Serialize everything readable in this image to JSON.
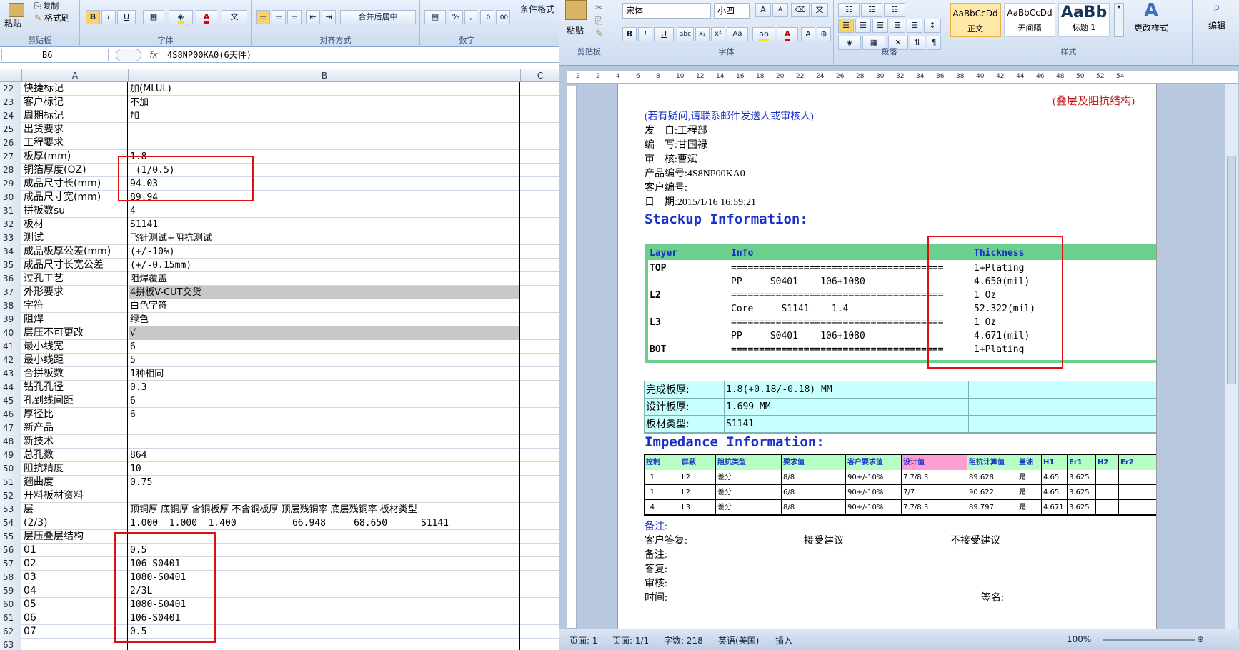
{
  "excel": {
    "ribbon": {
      "paste": "粘贴",
      "copy": "复制",
      "format_painter": "格式刷",
      "clipboard": "剪贴板",
      "font": "字体",
      "alignment": "对齐方式",
      "merge_center": "合并后居中",
      "number": "数字",
      "conditional_format": "条件格式",
      "bold": "B",
      "italic": "I",
      "underline": "U",
      "font_color_a": "A",
      "percent": "%",
      "comma": ","
    },
    "name_box": "B6",
    "fx": "fx",
    "formula_value": "4S8NP00KA0(6天件)",
    "columns": [
      "A",
      "B",
      "C"
    ],
    "rows": [
      {
        "n": "22",
        "a": "快捷标记",
        "b": "加(MLUL)"
      },
      {
        "n": "23",
        "a": "客户标记",
        "b": "不加"
      },
      {
        "n": "24",
        "a": "周期标记",
        "b": "加"
      },
      {
        "n": "25",
        "a": "出货要求",
        "b": ""
      },
      {
        "n": "26",
        "a": "工程要求",
        "b": ""
      },
      {
        "n": "27",
        "a": "板厚(mm)",
        "b": "1.8"
      },
      {
        "n": "28",
        "a": "铜箔厚度(OZ)",
        "b": " (1/0.5)"
      },
      {
        "n": "29",
        "a": "成品尺寸长(mm)",
        "b": "94.03"
      },
      {
        "n": "30",
        "a": "成品尺寸宽(mm)",
        "b": "89.94"
      },
      {
        "n": "31",
        "a": "拼板数su",
        "b": "4"
      },
      {
        "n": "32",
        "a": "板材",
        "b": "S1141"
      },
      {
        "n": "33",
        "a": "测试",
        "b": "飞针测试+阻抗测试"
      },
      {
        "n": "34",
        "a": "成品板厚公差(mm)",
        "b": "(+/-10%)"
      },
      {
        "n": "35",
        "a": "成品尺寸长宽公差",
        "b": "(+/-0.15mm)"
      },
      {
        "n": "36",
        "a": "过孔工艺",
        "b": "阻焊覆盖"
      },
      {
        "n": "37",
        "a": "外形要求",
        "b": "4拼板V-CUT交货"
      },
      {
        "n": "38",
        "a": "字符",
        "b": "白色字符"
      },
      {
        "n": "39",
        "a": "阻焊",
        "b": "绿色"
      },
      {
        "n": "40",
        "a": "层压不可更改",
        "b": "√"
      },
      {
        "n": "41",
        "a": "最小线宽",
        "b": "6"
      },
      {
        "n": "42",
        "a": "最小线距",
        "b": "5"
      },
      {
        "n": "43",
        "a": "合拼板数",
        "b": "1种相同"
      },
      {
        "n": "44",
        "a": "钻孔孔径",
        "b": "0.3"
      },
      {
        "n": "45",
        "a": "孔到线间距",
        "b": "6"
      },
      {
        "n": "46",
        "a": "厚径比",
        "b": "6"
      },
      {
        "n": "47",
        "a": "新产品",
        "b": ""
      },
      {
        "n": "48",
        "a": "新技术",
        "b": ""
      },
      {
        "n": "49",
        "a": "总孔数",
        "b": "864"
      },
      {
        "n": "50",
        "a": "阻抗精度",
        "b": "10"
      },
      {
        "n": "51",
        "a": "翘曲度",
        "b": "0.75"
      },
      {
        "n": "52",
        "a": "开料板材资料",
        "b": ""
      },
      {
        "n": "53",
        "a": "层",
        "b": "顶铜厚 底铜厚 含铜板厚 不含铜板厚 顶层残铜率 底层残铜率 板材类型"
      },
      {
        "n": "54",
        "a": "(2/3)",
        "b": "1.000  1.000  1.400          66.948     68.650      S1141"
      },
      {
        "n": "55",
        "a": "层压叠层结构",
        "b": ""
      },
      {
        "n": "56",
        "a": "01",
        "b": "0.5"
      },
      {
        "n": "57",
        "a": "02",
        "b": "106-S0401"
      },
      {
        "n": "58",
        "a": "03",
        "b": "1080-S0401"
      },
      {
        "n": "59",
        "a": "04",
        "b": "2/3L"
      },
      {
        "n": "60",
        "a": "05",
        "b": "1080-S0401"
      },
      {
        "n": "61",
        "a": "06",
        "b": "106-S0401"
      },
      {
        "n": "62",
        "a": "07",
        "b": "0.5"
      },
      {
        "n": "63",
        "a": "",
        "b": ""
      }
    ]
  },
  "word": {
    "ribbon": {
      "paste": "粘贴",
      "clipboard": "剪贴板",
      "font_name": "宋体",
      "font_size": "小四",
      "font": "字体",
      "paragraph": "段落",
      "styles": "样式",
      "style1_sample": "AaBbCcDd",
      "style1": "正文",
      "style2_sample": "AaBbCcDd",
      "style2": "无间隔",
      "style3_sample": "AaBb",
      "style3": "标题 1",
      "change_styles": "更改样式",
      "edit": "编辑"
    },
    "doc": {
      "subtitle": "(叠层及阻抗结构)",
      "note": "(若有疑问,请联系邮件发送人或审核人)",
      "from_label": "发    自:",
      "from": "工程部",
      "writer_label": "编    写:",
      "writer": "甘国禄",
      "reviewer_label": "审    核:",
      "reviewer": "曹斌",
      "product_label": "产品编号:",
      "product": "4S8NP00KA0",
      "customer_label": "客户编号:",
      "date_label": "日    期:",
      "date": "2015/1/16 16:59:21",
      "stackup_title": "Stackup Information:",
      "stack_headers": {
        "layer": "Layer",
        "info": "Info",
        "thickness": "Thickness"
      },
      "stack_rows": [
        {
          "layer": "TOP",
          "info": "======================================",
          "thickness": "1+Plating"
        },
        {
          "layer": "",
          "info": "PP     S0401    106+1080",
          "thickness": "4.650(mil)"
        },
        {
          "layer": "L2",
          "info": "======================================",
          "thickness": "1 Oz"
        },
        {
          "layer": "",
          "info": "Core     S1141    1.4",
          "thickness": "52.322(mil)"
        },
        {
          "layer": "L3",
          "info": "======================================",
          "thickness": "1 Oz"
        },
        {
          "layer": "",
          "info": "PP     S0401    106+1080",
          "thickness": "4.671(mil)"
        },
        {
          "layer": "BOT",
          "info": "======================================",
          "thickness": "1+Plating"
        }
      ],
      "thickness_rows": [
        {
          "label": "完成板厚:",
          "value": "1.8(+0.18/-0.18) MM"
        },
        {
          "label": "设计板厚:",
          "value": "1.699 MM"
        },
        {
          "label": "板材类型:",
          "value": "S1141"
        }
      ],
      "impedance_title": "Impedance Information:",
      "imp_headers": [
        "控制",
        "屏蔽",
        "阻抗类型",
        "要求值",
        "客户要求值",
        "设计值",
        "阻抗计算值",
        "盖油",
        "H1",
        "Er1",
        "H2",
        "Er2"
      ],
      "imp_rows": [
        [
          "L1",
          "L2",
          "差分",
          "8/8",
          "90+/-10%",
          "7.7/8.3",
          "89.628",
          "是",
          "4.65",
          "3.625",
          "",
          ""
        ],
        [
          "L1",
          "L2",
          "差分",
          "6/8",
          "90+/-10%",
          "7/7",
          "90.622",
          "是",
          "4.65",
          "3.625",
          "",
          ""
        ],
        [
          "L4",
          "L3",
          "差分",
          "8/8",
          "90+/-10%",
          "7.7/8.3",
          "89.797",
          "是",
          "4.671",
          "3.625",
          "",
          ""
        ]
      ],
      "remark_title": "备注:",
      "customer_reply": "客户答复:",
      "accept": "接受建议",
      "reject": "不接受建议",
      "remark": "备注:",
      "reply": "答复:",
      "audit": "审核:",
      "time": "时间:",
      "sign": "签名:"
    },
    "status": {
      "page": "页面: 1",
      "pages": "页面: 1/1",
      "words": "字数: 218",
      "lang": "英语(美国)",
      "insert": "插入",
      "zoom": "100%"
    },
    "ruler_numbers": [
      "2",
      "2",
      "4",
      "6",
      "8",
      "10",
      "12",
      "14",
      "16",
      "18",
      "20",
      "22",
      "24",
      "26",
      "28",
      "30",
      "32",
      "34",
      "36",
      "38",
      "40",
      "42",
      "44",
      "46",
      "48",
      "50",
      "52",
      "54"
    ]
  }
}
